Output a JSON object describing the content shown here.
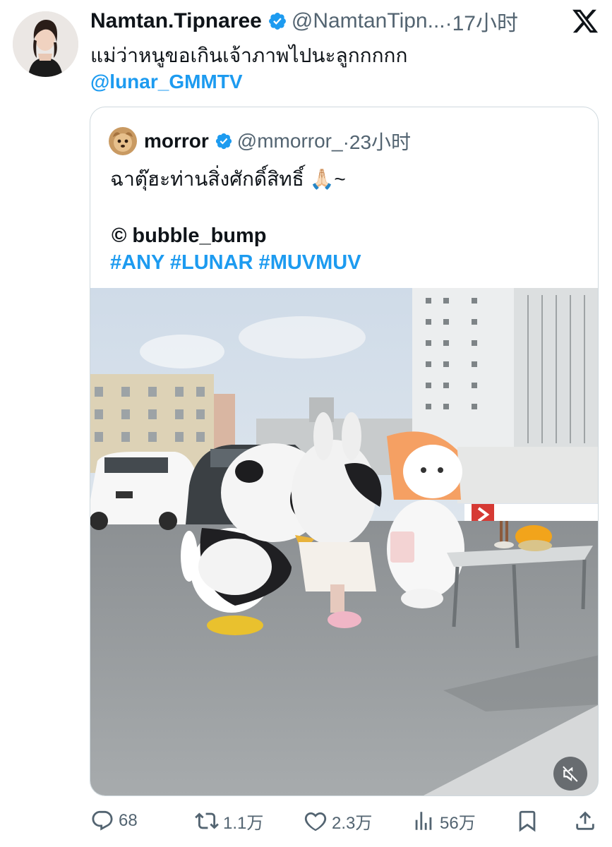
{
  "tweet": {
    "display_name": "Namtan.Tipnaree",
    "handle": "@NamtanTipn...",
    "time": "·17小时",
    "text": "แม่ว่าหนูขอเกินเจ้าภาพไปนะลูกกกกก",
    "mention": "@lunar_GMMTV"
  },
  "quoted": {
    "display_name": "morror",
    "handle": "@mmorror_",
    "time": "·23小时",
    "line1": "ฉาตุ๊ฮะท่านสิ่งศักดิ์สิทธิ์ 🙏🏻~",
    "line2": "© bubble_bump",
    "hashtags": "#ANY #LUNAR #MUVMUV"
  },
  "actions": {
    "replies": "68",
    "retweets": "1.1万",
    "likes": "2.3万",
    "views": "56万"
  },
  "colors": {
    "link": "#1d9bf0",
    "verified": "#1d9bf0",
    "secondary_text": "#536471",
    "border": "#cfd9de"
  },
  "icons": [
    "verified-badge-icon",
    "x-logo-icon",
    "mute-icon",
    "reply-icon",
    "retweet-icon",
    "like-icon",
    "views-icon",
    "bookmark-icon",
    "share-icon"
  ]
}
